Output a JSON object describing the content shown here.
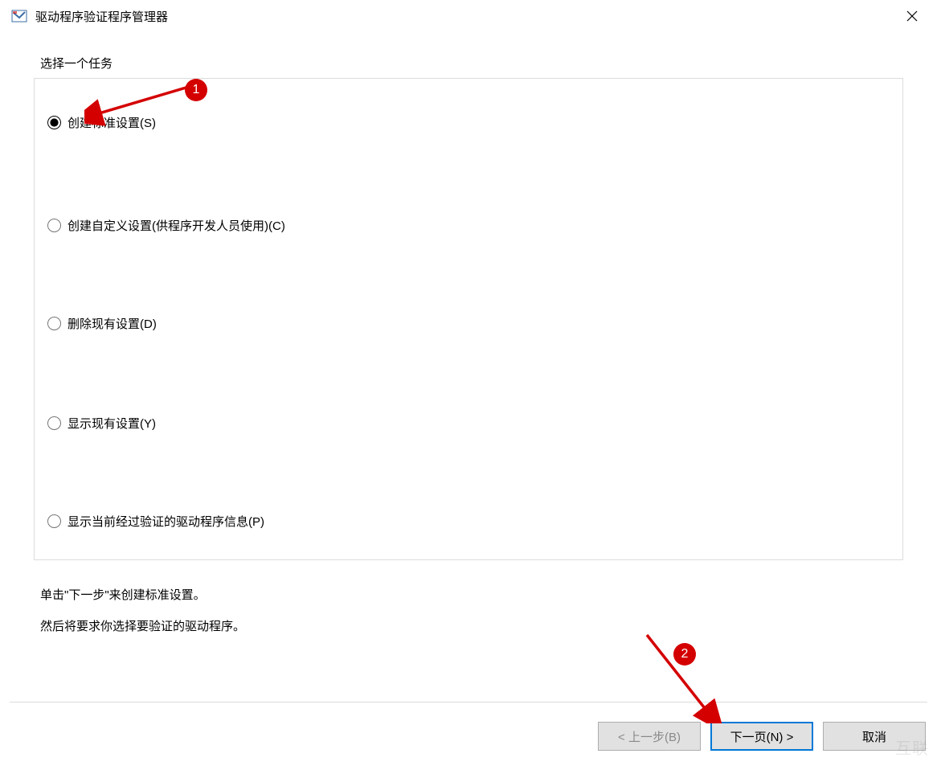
{
  "window": {
    "title": "驱动程序验证程序管理器"
  },
  "group": {
    "label": "选择一个任务",
    "options": [
      {
        "label": "创建标准设置(S)",
        "selected": true
      },
      {
        "label": "创建自定义设置(供程序开发人员使用)(C)",
        "selected": false
      },
      {
        "label": "删除现有设置(D)",
        "selected": false
      },
      {
        "label": "显示现有设置(Y)",
        "selected": false
      },
      {
        "label": "显示当前经过验证的驱动程序信息(P)",
        "selected": false
      }
    ]
  },
  "description": {
    "line1": "单击\"下一步\"来创建标准设置。",
    "line2": "然后将要求你选择要验证的驱动程序。"
  },
  "buttons": {
    "back": "< 上一步(B)",
    "next": "下一页(N) >",
    "cancel": "取消"
  },
  "annotations": {
    "badge1": "1",
    "badge2": "2"
  }
}
